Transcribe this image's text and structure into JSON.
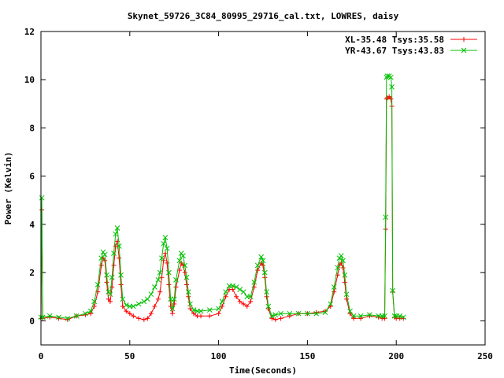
{
  "chart_data": {
    "type": "line",
    "title": "Skynet_59726_3C84_80995_29716_cal.txt, LOWRES, daisy",
    "xlabel": "Time(Seconds)",
    "ylabel": "Power (Kelvin)",
    "xlim": [
      0,
      250
    ],
    "ylim": [
      -1,
      12
    ],
    "xticks": [
      0,
      50,
      100,
      150,
      200,
      250
    ],
    "yticks": [
      0,
      2,
      4,
      6,
      8,
      10,
      12
    ],
    "grid": false,
    "legend_position": "top-right",
    "series": [
      {
        "name": "XL-35.48 Tsys:35.58",
        "color": "#ff0000",
        "marker": "plus",
        "points": [
          [
            0,
            0.1
          ],
          [
            0.5,
            4.6
          ],
          [
            1,
            0.1
          ],
          [
            5,
            0.15
          ],
          [
            10,
            0.1
          ],
          [
            15,
            0.05
          ],
          [
            20,
            0.2
          ],
          [
            25,
            0.25
          ],
          [
            28,
            0.3
          ],
          [
            30,
            0.6
          ],
          [
            32,
            1.2
          ],
          [
            34,
            2.3
          ],
          [
            35,
            2.6
          ],
          [
            36,
            2.5
          ],
          [
            37,
            1.6
          ],
          [
            38,
            0.9
          ],
          [
            39,
            0.8
          ],
          [
            40,
            1.4
          ],
          [
            41,
            2.3
          ],
          [
            42,
            3.1
          ],
          [
            43,
            3.3
          ],
          [
            44,
            2.6
          ],
          [
            45,
            1.5
          ],
          [
            46,
            0.6
          ],
          [
            48,
            0.4
          ],
          [
            50,
            0.3
          ],
          [
            52,
            0.2
          ],
          [
            55,
            0.1
          ],
          [
            58,
            0.05
          ],
          [
            60,
            0.1
          ],
          [
            62,
            0.3
          ],
          [
            64,
            0.6
          ],
          [
            66,
            0.9
          ],
          [
            67,
            1.2
          ],
          [
            68,
            1.8
          ],
          [
            69,
            2.5
          ],
          [
            70,
            2.8
          ],
          [
            71,
            2.4
          ],
          [
            72,
            1.5
          ],
          [
            73,
            0.6
          ],
          [
            74,
            0.3
          ],
          [
            75,
            0.7
          ],
          [
            76,
            1.4
          ],
          [
            78,
            2.1
          ],
          [
            79,
            2.4
          ],
          [
            80,
            2.3
          ],
          [
            81,
            2.0
          ],
          [
            82,
            1.5
          ],
          [
            83,
            1.0
          ],
          [
            84,
            0.5
          ],
          [
            86,
            0.3
          ],
          [
            88,
            0.2
          ],
          [
            90,
            0.2
          ],
          [
            95,
            0.2
          ],
          [
            100,
            0.3
          ],
          [
            102,
            0.6
          ],
          [
            104,
            1.0
          ],
          [
            106,
            1.3
          ],
          [
            108,
            1.3
          ],
          [
            110,
            1.0
          ],
          [
            112,
            0.8
          ],
          [
            114,
            0.7
          ],
          [
            116,
            0.6
          ],
          [
            118,
            0.8
          ],
          [
            120,
            1.4
          ],
          [
            122,
            2.1
          ],
          [
            124,
            2.4
          ],
          [
            125,
            2.3
          ],
          [
            126,
            1.8
          ],
          [
            127,
            1.0
          ],
          [
            128,
            0.5
          ],
          [
            130,
            0.1
          ],
          [
            132,
            0.05
          ],
          [
            135,
            0.1
          ],
          [
            140,
            0.2
          ],
          [
            145,
            0.3
          ],
          [
            150,
            0.3
          ],
          [
            155,
            0.35
          ],
          [
            160,
            0.4
          ],
          [
            163,
            0.6
          ],
          [
            165,
            1.2
          ],
          [
            167,
            1.9
          ],
          [
            168,
            2.3
          ],
          [
            169,
            2.4
          ],
          [
            170,
            2.2
          ],
          [
            171,
            1.6
          ],
          [
            172,
            0.9
          ],
          [
            174,
            0.3
          ],
          [
            176,
            0.1
          ],
          [
            180,
            0.1
          ],
          [
            185,
            0.2
          ],
          [
            190,
            0.15
          ],
          [
            192,
            0.1
          ],
          [
            193.5,
            0.1
          ],
          [
            194,
            3.8
          ],
          [
            194.5,
            9.2
          ],
          [
            195,
            9.25
          ],
          [
            196,
            9.3
          ],
          [
            197,
            9.2
          ],
          [
            197.5,
            8.9
          ],
          [
            198,
            1.2
          ],
          [
            199,
            0.15
          ],
          [
            200,
            0.1
          ],
          [
            202,
            0.1
          ],
          [
            204,
            0.1
          ]
        ]
      },
      {
        "name": "YR-43.67 Tsys:43.83",
        "color": "#00c000",
        "marker": "cross",
        "points": [
          [
            0,
            0.15
          ],
          [
            0.5,
            5.1
          ],
          [
            1,
            0.15
          ],
          [
            5,
            0.2
          ],
          [
            10,
            0.15
          ],
          [
            15,
            0.1
          ],
          [
            20,
            0.2
          ],
          [
            25,
            0.3
          ],
          [
            28,
            0.4
          ],
          [
            30,
            0.8
          ],
          [
            32,
            1.5
          ],
          [
            34,
            2.6
          ],
          [
            35,
            2.85
          ],
          [
            36,
            2.75
          ],
          [
            37,
            1.9
          ],
          [
            38,
            1.2
          ],
          [
            39,
            1.1
          ],
          [
            40,
            1.8
          ],
          [
            41,
            2.8
          ],
          [
            42,
            3.6
          ],
          [
            43,
            3.85
          ],
          [
            44,
            3.1
          ],
          [
            45,
            1.9
          ],
          [
            46,
            0.9
          ],
          [
            48,
            0.65
          ],
          [
            50,
            0.6
          ],
          [
            52,
            0.6
          ],
          [
            55,
            0.7
          ],
          [
            58,
            0.8
          ],
          [
            60,
            0.9
          ],
          [
            62,
            1.1
          ],
          [
            64,
            1.4
          ],
          [
            66,
            1.7
          ],
          [
            67,
            2.0
          ],
          [
            68,
            2.6
          ],
          [
            69,
            3.2
          ],
          [
            70,
            3.45
          ],
          [
            71,
            3.0
          ],
          [
            72,
            2.0
          ],
          [
            73,
            0.9
          ],
          [
            74,
            0.5
          ],
          [
            75,
            0.9
          ],
          [
            76,
            1.7
          ],
          [
            78,
            2.5
          ],
          [
            79,
            2.8
          ],
          [
            80,
            2.7
          ],
          [
            81,
            2.3
          ],
          [
            82,
            1.8
          ],
          [
            83,
            1.2
          ],
          [
            84,
            0.7
          ],
          [
            86,
            0.45
          ],
          [
            88,
            0.4
          ],
          [
            90,
            0.4
          ],
          [
            95,
            0.45
          ],
          [
            100,
            0.5
          ],
          [
            102,
            0.8
          ],
          [
            104,
            1.2
          ],
          [
            106,
            1.45
          ],
          [
            108,
            1.45
          ],
          [
            110,
            1.4
          ],
          [
            112,
            1.3
          ],
          [
            114,
            1.2
          ],
          [
            116,
            1.0
          ],
          [
            118,
            1.0
          ],
          [
            120,
            1.6
          ],
          [
            122,
            2.3
          ],
          [
            124,
            2.65
          ],
          [
            125,
            2.5
          ],
          [
            126,
            2.0
          ],
          [
            127,
            1.2
          ],
          [
            128,
            0.6
          ],
          [
            130,
            0.2
          ],
          [
            132,
            0.25
          ],
          [
            135,
            0.3
          ],
          [
            140,
            0.3
          ],
          [
            145,
            0.3
          ],
          [
            150,
            0.3
          ],
          [
            155,
            0.3
          ],
          [
            160,
            0.35
          ],
          [
            163,
            0.7
          ],
          [
            165,
            1.4
          ],
          [
            167,
            2.2
          ],
          [
            168,
            2.6
          ],
          [
            169,
            2.7
          ],
          [
            170,
            2.5
          ],
          [
            171,
            1.9
          ],
          [
            172,
            1.1
          ],
          [
            174,
            0.4
          ],
          [
            176,
            0.2
          ],
          [
            180,
            0.2
          ],
          [
            185,
            0.25
          ],
          [
            190,
            0.2
          ],
          [
            192,
            0.2
          ],
          [
            193.5,
            0.2
          ],
          [
            194,
            4.3
          ],
          [
            194.5,
            10.1
          ],
          [
            195,
            10.15
          ],
          [
            196,
            10.15
          ],
          [
            197,
            10.1
          ],
          [
            197.5,
            9.7
          ],
          [
            198,
            1.25
          ],
          [
            199,
            0.2
          ],
          [
            200,
            0.2
          ],
          [
            202,
            0.2
          ],
          [
            204,
            0.15
          ]
        ]
      }
    ]
  }
}
